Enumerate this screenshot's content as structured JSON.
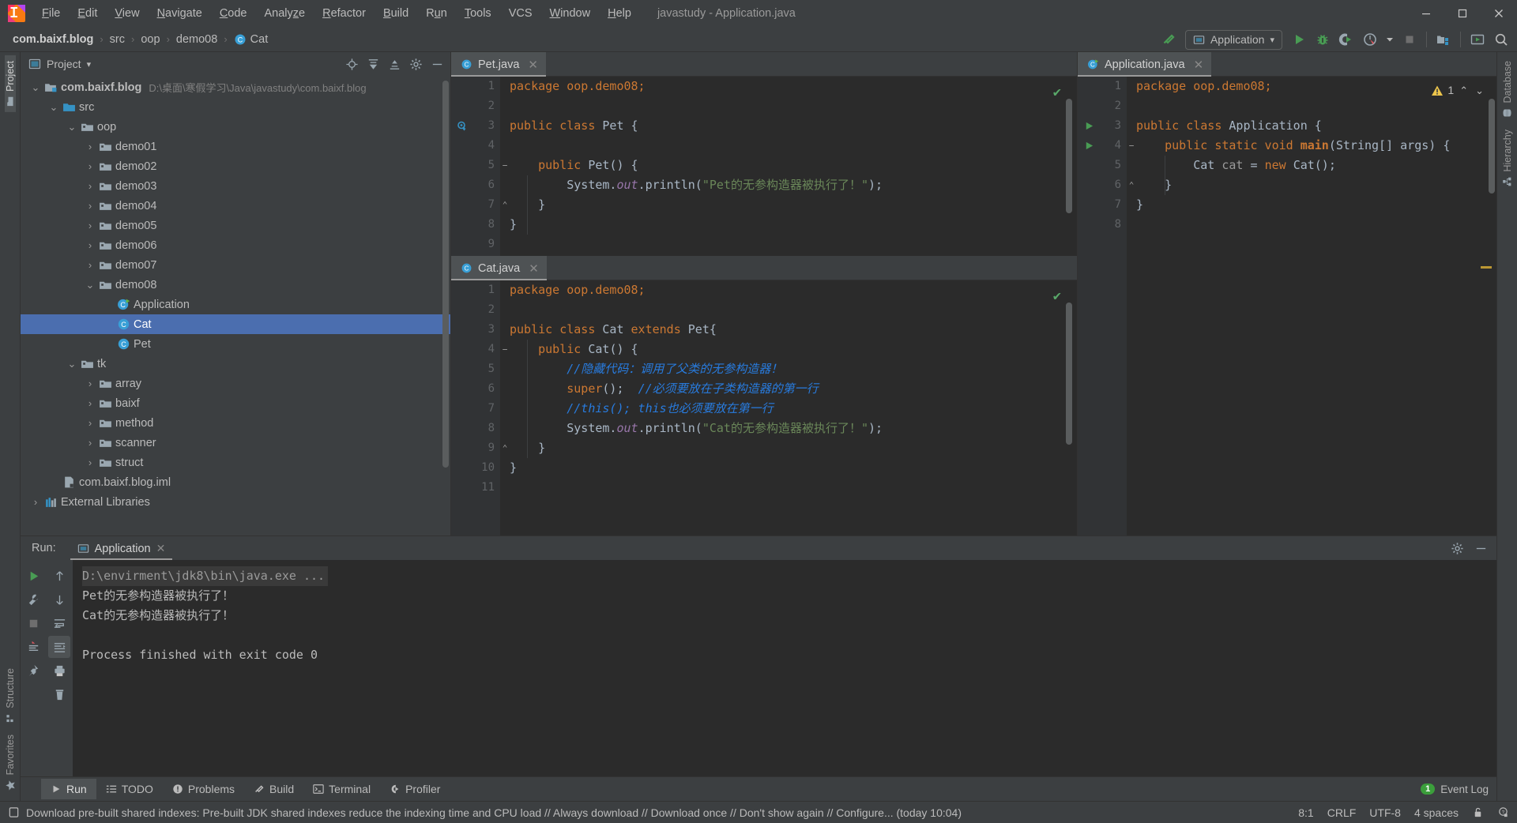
{
  "window": {
    "title": "javastudy - Application.java",
    "min_label": "—",
    "max_label": "❐",
    "close_label": "✕"
  },
  "menu": [
    {
      "label": "File",
      "mnemonic": "F"
    },
    {
      "label": "Edit",
      "mnemonic": "E"
    },
    {
      "label": "View",
      "mnemonic": "V"
    },
    {
      "label": "Navigate",
      "mnemonic": "N"
    },
    {
      "label": "Code",
      "mnemonic": "C"
    },
    {
      "label": "Analyze",
      "mnemonic": "z"
    },
    {
      "label": "Refactor",
      "mnemonic": "R"
    },
    {
      "label": "Build",
      "mnemonic": "B"
    },
    {
      "label": "Run",
      "mnemonic": "u"
    },
    {
      "label": "Tools",
      "mnemonic": "T"
    },
    {
      "label": "VCS",
      "mnemonic": ""
    },
    {
      "label": "Window",
      "mnemonic": "W"
    },
    {
      "label": "Help",
      "mnemonic": "H"
    }
  ],
  "breadcrumb": {
    "items": [
      "com.baixf.blog",
      "src",
      "oop",
      "demo08",
      "Cat"
    ],
    "separator": "›",
    "last_icon": "class-icon"
  },
  "toolbar": {
    "run_config": "Application",
    "run_config_caret": "▾",
    "buttons": [
      {
        "name": "build-icon",
        "label": ""
      },
      {
        "name": "run-icon",
        "label": ""
      },
      {
        "name": "debug-icon",
        "label": ""
      },
      {
        "name": "run-coverage-icon",
        "label": ""
      },
      {
        "name": "profiler-icon",
        "label": ""
      },
      {
        "name": "dropdown-icon",
        "label": "▾"
      },
      {
        "name": "stop-icon",
        "label": ""
      },
      {
        "name": "project-structure-icon",
        "label": ""
      },
      {
        "name": "updates-icon",
        "label": ""
      },
      {
        "name": "search-everywhere-icon",
        "label": ""
      }
    ]
  },
  "left_strip": {
    "top": [
      {
        "label": "Project",
        "icon": "folder-icon",
        "active": true
      }
    ],
    "bottom": [
      {
        "label": "Structure",
        "icon": "structure-icon",
        "active": false
      },
      {
        "label": "Favorites",
        "icon": "star-icon",
        "active": false
      }
    ]
  },
  "right_strip": [
    {
      "label": "Database",
      "icon": "database-icon"
    },
    {
      "label": "Hierarchy",
      "icon": "hierarchy-icon"
    }
  ],
  "project": {
    "title": "Project",
    "caret": "▾",
    "tools": [
      {
        "name": "locate-icon"
      },
      {
        "name": "expand-all-icon"
      },
      {
        "name": "collapse-all-icon"
      },
      {
        "name": "settings-gear-icon"
      },
      {
        "name": "hide-icon"
      }
    ],
    "tree": [
      {
        "indent": 0,
        "twist": "⌄",
        "icon": "module-icon",
        "name": "com.baixf.blog",
        "bold": true,
        "path": "D:\\桌面\\寒假学习\\Java\\javastudy\\com.baixf.blog",
        "selected": false
      },
      {
        "indent": 1,
        "twist": "⌄",
        "icon": "source-folder-icon",
        "name": "src",
        "bold": false,
        "path": "",
        "selected": false
      },
      {
        "indent": 2,
        "twist": "⌄",
        "icon": "package-icon",
        "name": "oop",
        "bold": false,
        "path": "",
        "selected": false
      },
      {
        "indent": 3,
        "twist": "›",
        "icon": "package-icon",
        "name": "demo01",
        "bold": false,
        "path": "",
        "selected": false
      },
      {
        "indent": 3,
        "twist": "›",
        "icon": "package-icon",
        "name": "demo02",
        "bold": false,
        "path": "",
        "selected": false
      },
      {
        "indent": 3,
        "twist": "›",
        "icon": "package-icon",
        "name": "demo03",
        "bold": false,
        "path": "",
        "selected": false
      },
      {
        "indent": 3,
        "twist": "›",
        "icon": "package-icon",
        "name": "demo04",
        "bold": false,
        "path": "",
        "selected": false
      },
      {
        "indent": 3,
        "twist": "›",
        "icon": "package-icon",
        "name": "demo05",
        "bold": false,
        "path": "",
        "selected": false
      },
      {
        "indent": 3,
        "twist": "›",
        "icon": "package-icon",
        "name": "demo06",
        "bold": false,
        "path": "",
        "selected": false
      },
      {
        "indent": 3,
        "twist": "›",
        "icon": "package-icon",
        "name": "demo07",
        "bold": false,
        "path": "",
        "selected": false
      },
      {
        "indent": 3,
        "twist": "⌄",
        "icon": "package-icon",
        "name": "demo08",
        "bold": false,
        "path": "",
        "selected": false
      },
      {
        "indent": 4,
        "twist": "",
        "icon": "runnable-class-icon",
        "name": "Application",
        "bold": false,
        "path": "",
        "selected": false
      },
      {
        "indent": 4,
        "twist": "",
        "icon": "class-icon",
        "name": "Cat",
        "bold": false,
        "path": "",
        "selected": true
      },
      {
        "indent": 4,
        "twist": "",
        "icon": "class-icon",
        "name": "Pet",
        "bold": false,
        "path": "",
        "selected": false
      },
      {
        "indent": 2,
        "twist": "⌄",
        "icon": "package-icon",
        "name": "tk",
        "bold": false,
        "path": "",
        "selected": false
      },
      {
        "indent": 3,
        "twist": "›",
        "icon": "package-icon",
        "name": "array",
        "bold": false,
        "path": "",
        "selected": false
      },
      {
        "indent": 3,
        "twist": "›",
        "icon": "package-icon",
        "name": "baixf",
        "bold": false,
        "path": "",
        "selected": false
      },
      {
        "indent": 3,
        "twist": "›",
        "icon": "package-icon",
        "name": "method",
        "bold": false,
        "path": "",
        "selected": false
      },
      {
        "indent": 3,
        "twist": "›",
        "icon": "package-icon",
        "name": "scanner",
        "bold": false,
        "path": "",
        "selected": false
      },
      {
        "indent": 3,
        "twist": "›",
        "icon": "package-icon",
        "name": "struct",
        "bold": false,
        "path": "",
        "selected": false
      },
      {
        "indent": 1,
        "twist": "",
        "icon": "iml-file-icon",
        "name": "com.baixf.blog.iml",
        "bold": false,
        "path": "",
        "selected": false
      },
      {
        "indent": 0,
        "twist": "›",
        "icon": "libraries-icon",
        "name": "External Libraries",
        "bold": false,
        "path": "",
        "selected": false
      }
    ]
  },
  "editors": {
    "pet": {
      "tab": "Pet.java",
      "tab_icon": "class-icon",
      "close": "✕",
      "inspection": "✔",
      "first_line": 1,
      "lines": [
        {
          "n": 1,
          "tokens": [
            {
              "t": "package oop.demo08;",
              "c": "kw-pkg"
            }
          ]
        },
        {
          "n": 2,
          "tokens": []
        },
        {
          "n": 3,
          "tokens": [
            {
              "t": "public class ",
              "c": "kw"
            },
            {
              "t": "Pet ",
              "c": "ident"
            },
            {
              "t": "{",
              "c": "ident"
            }
          ],
          "gutter_mark": "bean-icon"
        },
        {
          "n": 4,
          "tokens": []
        },
        {
          "n": 5,
          "tokens": [
            {
              "t": "    ",
              "c": "ident"
            },
            {
              "t": "public ",
              "c": "kw"
            },
            {
              "t": "Pet",
              "c": "ident"
            },
            {
              "t": "() {",
              "c": "ident"
            }
          ],
          "fold": "−"
        },
        {
          "n": 6,
          "tokens": [
            {
              "t": "        System.",
              "c": "ident"
            },
            {
              "t": "out",
              "c": "fld"
            },
            {
              "t": ".println(",
              "c": "ident"
            },
            {
              "t": "\"Pet的无参构造器被执行了！\"",
              "c": "str"
            },
            {
              "t": ");",
              "c": "ident"
            }
          ]
        },
        {
          "n": 7,
          "tokens": [
            {
              "t": "    }",
              "c": "ident"
            }
          ],
          "fold": "⌃"
        },
        {
          "n": 8,
          "tokens": [
            {
              "t": "}",
              "c": "ident"
            }
          ]
        },
        {
          "n": 9,
          "tokens": []
        }
      ]
    },
    "cat": {
      "tab": "Cat.java",
      "tab_icon": "class-icon",
      "close": "✕",
      "inspection": "✔",
      "lines": [
        {
          "n": 1,
          "tokens": [
            {
              "t": "package oop.demo08;",
              "c": "kw-pkg"
            }
          ]
        },
        {
          "n": 2,
          "tokens": []
        },
        {
          "n": 3,
          "tokens": [
            {
              "t": "public class ",
              "c": "kw"
            },
            {
              "t": "Cat ",
              "c": "ident"
            },
            {
              "t": "extends ",
              "c": "kw"
            },
            {
              "t": "Pet{",
              "c": "ident"
            }
          ]
        },
        {
          "n": 4,
          "tokens": [
            {
              "t": "    ",
              "c": "ident"
            },
            {
              "t": "public ",
              "c": "kw"
            },
            {
              "t": "Cat",
              "c": "ident"
            },
            {
              "t": "() {",
              "c": "ident"
            }
          ],
          "fold": "−"
        },
        {
          "n": 5,
          "tokens": [
            {
              "t": "        //隐藏代码：调用了父类的无参构造器！",
              "c": "cmt-i"
            }
          ]
        },
        {
          "n": 6,
          "tokens": [
            {
              "t": "        ",
              "c": "ident"
            },
            {
              "t": "super",
              "c": "kw"
            },
            {
              "t": "();  ",
              "c": "ident"
            },
            {
              "t": "//必须要放在子类构造器的第一行",
              "c": "cmt-i"
            }
          ]
        },
        {
          "n": 7,
          "tokens": [
            {
              "t": "        //this(); this也必须要放在第一行",
              "c": "cmt-i"
            }
          ]
        },
        {
          "n": 8,
          "tokens": [
            {
              "t": "        System.",
              "c": "ident"
            },
            {
              "t": "out",
              "c": "fld"
            },
            {
              "t": ".println(",
              "c": "ident"
            },
            {
              "t": "\"Cat的无参构造器被执行了！\"",
              "c": "str"
            },
            {
              "t": ");",
              "c": "ident"
            }
          ]
        },
        {
          "n": 9,
          "tokens": [
            {
              "t": "    }",
              "c": "ident"
            }
          ],
          "fold": "⌃"
        },
        {
          "n": 10,
          "tokens": [
            {
              "t": "}",
              "c": "ident"
            }
          ]
        },
        {
          "n": 11,
          "tokens": []
        }
      ]
    },
    "application": {
      "tab": "Application.java",
      "tab_icon": "runnable-class-icon",
      "close": "✕",
      "warning_count": "1",
      "warning_icon": "warning-triangle-icon",
      "nav_up": "⌃",
      "nav_down": "⌄",
      "lines": [
        {
          "n": 1,
          "tokens": [
            {
              "t": "package oop.demo08;",
              "c": "kw-pkg"
            }
          ]
        },
        {
          "n": 2,
          "tokens": []
        },
        {
          "n": 3,
          "tokens": [
            {
              "t": "public class ",
              "c": "kw"
            },
            {
              "t": "Application ",
              "c": "ident"
            },
            {
              "t": "{",
              "c": "ident"
            }
          ],
          "gutter_mark": "run-arrow-icon"
        },
        {
          "n": 4,
          "tokens": [
            {
              "t": "    ",
              "c": "ident"
            },
            {
              "t": "public static void ",
              "c": "kw"
            },
            {
              "t": "main",
              "c": "kw-b"
            },
            {
              "t": "(String[] args) {",
              "c": "ident"
            }
          ],
          "gutter_mark": "run-arrow-icon",
          "fold": "−"
        },
        {
          "n": 5,
          "tokens": [
            {
              "t": "        Cat ",
              "c": "ident"
            },
            {
              "t": "cat ",
              "c": "local-grey"
            },
            {
              "t": "= ",
              "c": "ident"
            },
            {
              "t": "new ",
              "c": "kw"
            },
            {
              "t": "Cat();",
              "c": "ident"
            }
          ]
        },
        {
          "n": 6,
          "tokens": [
            {
              "t": "    }",
              "c": "ident"
            }
          ],
          "fold": "⌃"
        },
        {
          "n": 7,
          "tokens": [
            {
              "t": "}",
              "c": "ident"
            }
          ]
        },
        {
          "n": 8,
          "tokens": []
        }
      ]
    }
  },
  "run_window": {
    "label": "Run:",
    "tab": "Application",
    "tab_icon": "run-config-icon",
    "tab_close": "✕",
    "header_tools": [
      {
        "name": "settings-gear-icon"
      },
      {
        "name": "hide-icon"
      }
    ],
    "side_buttons": [
      {
        "name": "rerun-icon"
      },
      {
        "name": "wrench-icon"
      },
      {
        "name": "stop-icon"
      },
      {
        "name": "dump-threads-icon"
      }
    ],
    "side_buttons2": [
      {
        "name": "up-arrow-icon"
      },
      {
        "name": "down-arrow-icon"
      },
      {
        "name": "soft-wrap-icon"
      },
      {
        "name": "scroll-to-end-icon"
      },
      {
        "name": "print-icon"
      },
      {
        "name": "clear-all-icon"
      }
    ],
    "console": [
      {
        "text": "D:\\envirment\\jdk8\\bin\\java.exe ...",
        "type": "cmd"
      },
      {
        "text": "Pet的无参构造器被执行了！",
        "type": "out"
      },
      {
        "text": "Cat的无参构造器被执行了！",
        "type": "out"
      },
      {
        "text": "",
        "type": "out"
      },
      {
        "text": "Process finished with exit code 0",
        "type": "out"
      }
    ]
  },
  "bottom_tabs": [
    {
      "label": "Run",
      "icon": "run-icon",
      "active": true
    },
    {
      "label": "TODO",
      "icon": "todo-icon",
      "active": false
    },
    {
      "label": "Problems",
      "icon": "problems-icon",
      "active": false
    },
    {
      "label": "Build",
      "icon": "build-hammer-icon",
      "active": false
    },
    {
      "label": "Terminal",
      "icon": "terminal-icon",
      "active": false
    },
    {
      "label": "Profiler",
      "icon": "profiler-icon",
      "active": false
    }
  ],
  "event_log": {
    "count": "1",
    "label": "Event Log",
    "icon": "event-log-icon"
  },
  "status": {
    "icon": "notification-icon",
    "message": "Download pre-built shared indexes: Pre-built JDK shared indexes reduce the indexing time and CPU load // Always download // Download once // Don't show again // Configure... (today 10:04)",
    "caret": "8:1",
    "line_sep": "CRLF",
    "encoding": "UTF-8",
    "indent": "4 spaces",
    "lock_icon": "lock-icon",
    "inspection_icon": "inspection-level-icon"
  },
  "colors": {
    "bg_chrome": "#3c3f41",
    "bg_editor": "#2b2b2b",
    "accent_selection": "#4b6eaf",
    "keyword": "#cc7832",
    "string": "#6a8759",
    "comment_italic": "#287bde",
    "field": "#9876aa",
    "ok_green": "#59a869",
    "warn_yellow": "#bb9733"
  }
}
